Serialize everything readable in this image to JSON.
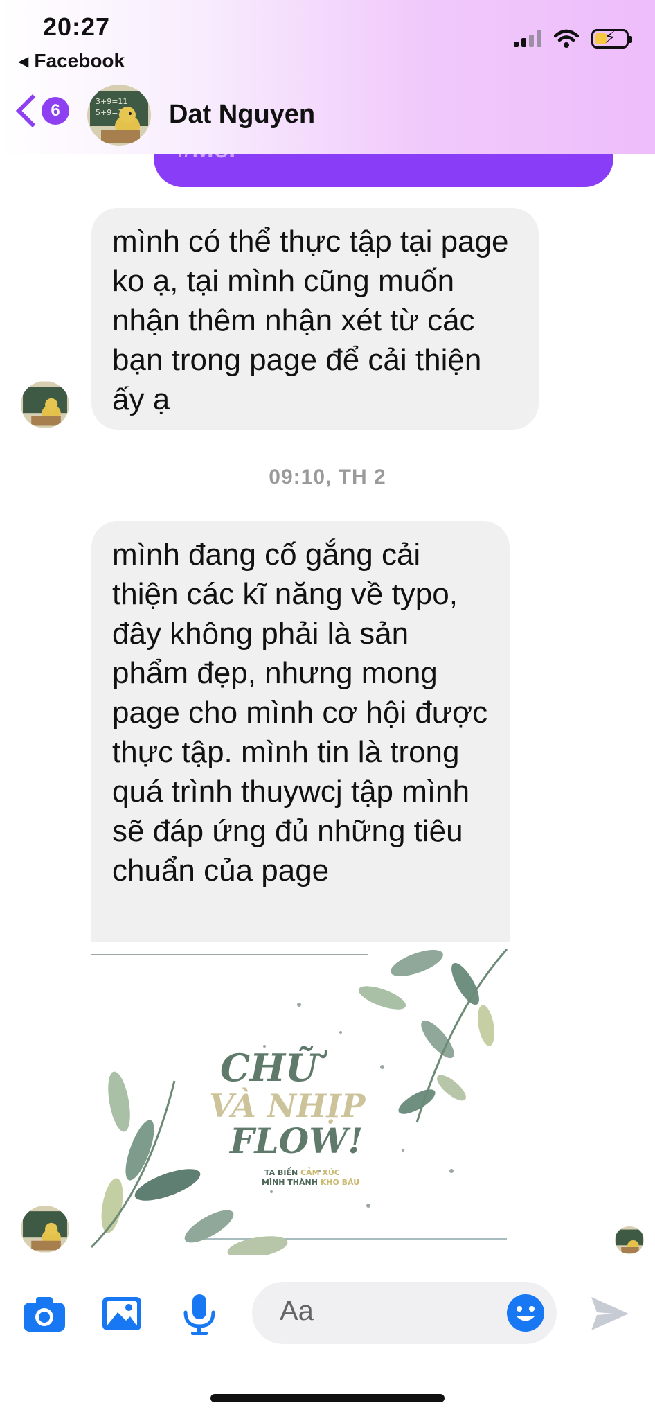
{
  "status_bar": {
    "time": "20:27",
    "back_app": "Facebook"
  },
  "header": {
    "unread_count": "6",
    "contact_name": "Dat Nguyen"
  },
  "chat": {
    "sent_bubble_partial": "#Mèi",
    "messages": [
      {
        "text": "mình có thể thực tập tại page ko ạ, tại mình cũng muốn nhận thêm nhận xét từ các bạn trong page để cải thiện ấy ạ"
      },
      {
        "text": "mình đang cố gắng cải thiện các kĩ năng về typo, đây không phải là sản phẩm đẹp, nhưng mong page cho mình cơ hội được thực tập. mình tin là trong quá trình thuywcj tập mình sẽ đáp ứng đủ những tiêu chuẩn của page"
      }
    ],
    "timestamp": "09:10, TH 2",
    "poster": {
      "title_lines": [
        "CHỮ",
        "VÀ NHỊP",
        "FLOW!"
      ],
      "tagline_line1_a": "TA BIẾN ",
      "tagline_line1_b": "CẢM XÚC",
      "tagline_line2_a": "MÌNH THÀNH ",
      "tagline_line2_b": "KHO BÁU"
    }
  },
  "composer": {
    "placeholder": "Aa",
    "icons": [
      "camera-icon",
      "image-icon",
      "microphone-icon",
      "emoji-icon",
      "send-icon"
    ]
  },
  "colors": {
    "accent": "#8a3df6",
    "icon_blue": "#1877f2",
    "bubble_gray": "#f0f0f0"
  }
}
